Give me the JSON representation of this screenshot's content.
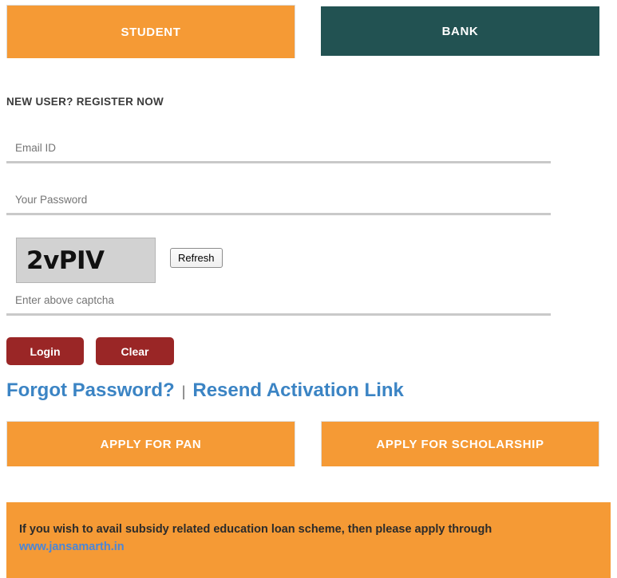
{
  "tabs": [
    {
      "id": "student",
      "label": "STUDENT",
      "active": true,
      "color": "#f59a35"
    },
    {
      "id": "bank",
      "label": "BANK",
      "active": false,
      "color": "#225252"
    }
  ],
  "register": {
    "label": "NEW USER? REGISTER NOW"
  },
  "form": {
    "email": {
      "placeholder": "Email ID",
      "value": ""
    },
    "password": {
      "placeholder": "Your Password",
      "value": ""
    },
    "captcha_entry": {
      "placeholder": "Enter above captcha",
      "value": ""
    },
    "captcha": {
      "text": "2vPIV",
      "refresh_label": "Refresh"
    },
    "buttons": {
      "login_label": "Login",
      "clear_label": "Clear"
    }
  },
  "links": {
    "forgot_password": "Forgot Password?",
    "separator": "|",
    "resend_activation": "Resend Activation Link"
  },
  "apply_buttons": [
    {
      "id": "pan",
      "label": "APPLY FOR PAN"
    },
    {
      "id": "scholarship",
      "label": "APPLY FOR SCHOLARSHIP"
    }
  ],
  "footer": {
    "message": "If you wish to avail subsidy related education loan scheme, then please apply through",
    "link_text": "www.jansamarth.in"
  },
  "colors": {
    "orange": "#f59a35",
    "teal": "#225252",
    "dark_red": "#9a2626",
    "link_blue": "#3b84c4",
    "footer_link_blue": "#4a86d8",
    "rule_gray": "#c9c9c9"
  }
}
